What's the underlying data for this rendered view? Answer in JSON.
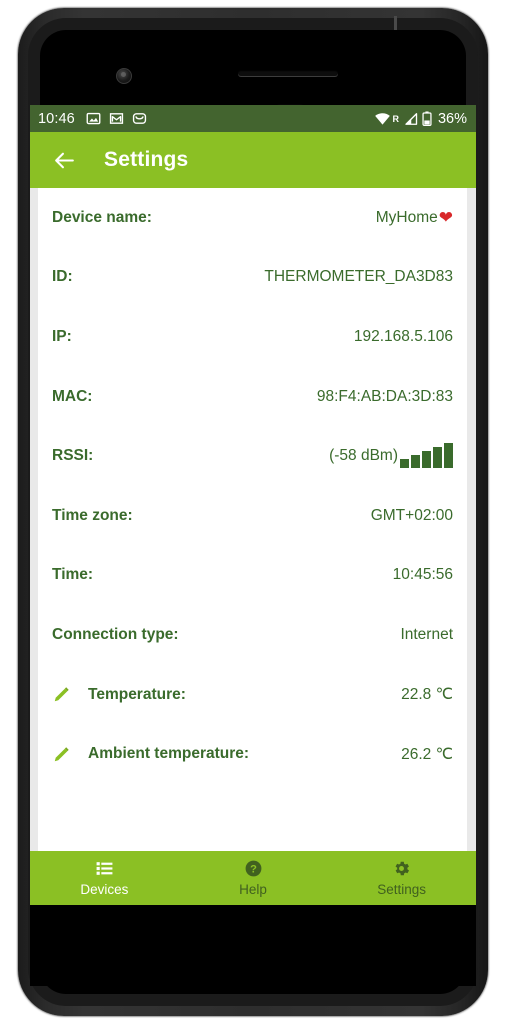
{
  "status_bar": {
    "clock": "10:46",
    "battery_percent": "36%",
    "icons_left": [
      "photo-icon",
      "gmail-icon",
      "mail-icon"
    ],
    "icons_right": [
      "wifi-icon",
      "roaming-r-icon",
      "cellular-signal-icon",
      "battery-icon"
    ],
    "background_color": "#43642f"
  },
  "app_bar": {
    "back_icon": "arrow-left-icon",
    "title": "Settings",
    "background_color": "#8bc024"
  },
  "settings": {
    "rows": [
      {
        "label": "Device name:",
        "value": "MyHome",
        "suffix": "❤",
        "editable": false
      },
      {
        "label": "ID:",
        "value": "THERMOMETER_DA3D83",
        "editable": false
      },
      {
        "label": "IP:",
        "value": "192.168.5.106",
        "editable": false
      },
      {
        "label": "MAC:",
        "value": "98:F4:AB:DA:3D:83",
        "editable": false
      },
      {
        "label": "RSSI:",
        "value": "(-58 dBm)",
        "signal_bars": 5,
        "editable": false
      },
      {
        "label": "Time zone:",
        "value": "GMT+02:00",
        "editable": false
      },
      {
        "label": "Time:",
        "value": "10:45:56",
        "editable": false
      },
      {
        "label": "Connection type:",
        "value": "Internet",
        "editable": false
      },
      {
        "label": "Temperature:",
        "value": "22.8 ℃",
        "editable": true
      },
      {
        "label": "Ambient temperature:",
        "value": "26.2 ℃",
        "editable": true
      }
    ]
  },
  "tab_bar": {
    "tabs": [
      {
        "label": "Devices",
        "icon": "list-icon",
        "active": true
      },
      {
        "label": "Help",
        "icon": "help-circle-icon",
        "active": false
      },
      {
        "label": "Settings",
        "icon": "gear-icon",
        "active": false
      }
    ]
  },
  "nav_bar": {
    "back": "back-triangle-icon",
    "home": "home-circle-icon",
    "recents": "recents-square-icon"
  },
  "colors": {
    "primary_green": "#8bc024",
    "dark_green": "#3a6b2c",
    "status_bar_green": "#43642f",
    "nav_bar_green": "#4a6b30",
    "heart_red": "#d8282a"
  }
}
